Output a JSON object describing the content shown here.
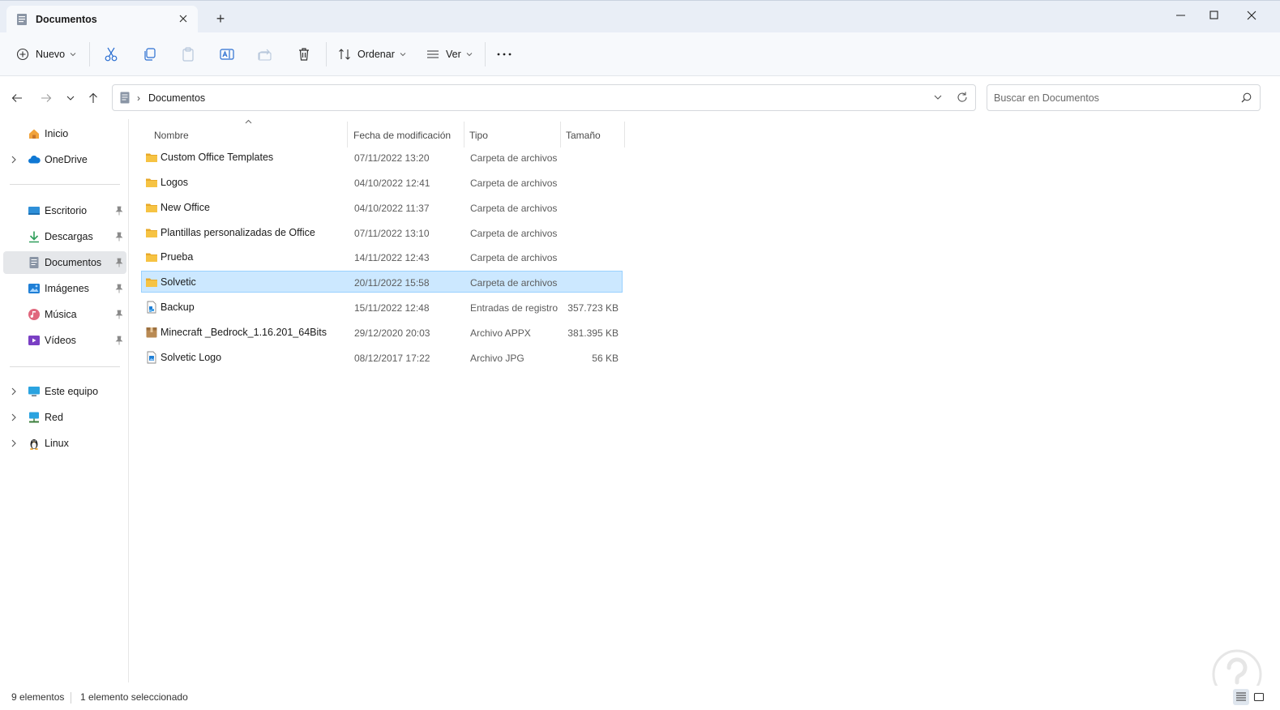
{
  "window": {
    "tab_title": "Documentos",
    "new_tab_label": "+"
  },
  "toolbar": {
    "new_label": "Nuevo",
    "sort_label": "Ordenar",
    "view_label": "Ver",
    "more_label": "···"
  },
  "address": {
    "crumb": "Documentos",
    "search_placeholder": "Buscar en Documentos"
  },
  "sidebar": {
    "items": [
      {
        "label": "Inicio",
        "icon": "home-icon"
      },
      {
        "label": "OneDrive",
        "icon": "cloud-icon"
      },
      {
        "label": "Escritorio",
        "icon": "desktop-icon"
      },
      {
        "label": "Descargas",
        "icon": "download-icon"
      },
      {
        "label": "Documentos",
        "icon": "document-icon"
      },
      {
        "label": "Imágenes",
        "icon": "image-icon"
      },
      {
        "label": "Música",
        "icon": "music-icon"
      },
      {
        "label": "Vídeos",
        "icon": "video-icon"
      },
      {
        "label": "Este equipo",
        "icon": "computer-icon"
      },
      {
        "label": "Red",
        "icon": "network-icon"
      },
      {
        "label": "Linux",
        "icon": "linux-icon"
      }
    ]
  },
  "files": {
    "columns": [
      "Nombre",
      "Fecha de modificación",
      "Tipo",
      "Tamaño"
    ],
    "rows": [
      {
        "name": "Custom Office Templates",
        "date": "07/11/2022 13:20",
        "type": "Carpeta de archivos",
        "size": "",
        "icon": "folder-icon"
      },
      {
        "name": "Logos",
        "date": "04/10/2022 12:41",
        "type": "Carpeta de archivos",
        "size": "",
        "icon": "folder-icon"
      },
      {
        "name": "New Office",
        "date": "04/10/2022 11:37",
        "type": "Carpeta de archivos",
        "size": "",
        "icon": "folder-icon"
      },
      {
        "name": "Plantillas personalizadas de Office",
        "date": "07/11/2022 13:10",
        "type": "Carpeta de archivos",
        "size": "",
        "icon": "folder-icon"
      },
      {
        "name": "Prueba",
        "date": "14/11/2022 12:43",
        "type": "Carpeta de archivos",
        "size": "",
        "icon": "folder-icon"
      },
      {
        "name": "Solvetic",
        "date": "20/11/2022 15:58",
        "type": "Carpeta de archivos",
        "size": "",
        "icon": "folder-icon",
        "selected": true
      },
      {
        "name": "Backup",
        "date": "15/11/2022 12:48",
        "type": "Entradas de registro",
        "size": "357.723 KB",
        "icon": "registry-file-icon"
      },
      {
        "name": "Minecraft _Bedrock_1.16.201_64Bits",
        "date": "29/12/2020 20:03",
        "type": "Archivo APPX",
        "size": "381.395 KB",
        "icon": "package-icon"
      },
      {
        "name": "Solvetic Logo",
        "date": "08/12/2017 17:22",
        "type": "Archivo JPG",
        "size": "56 KB",
        "icon": "image-file-icon"
      }
    ]
  },
  "status": {
    "count": "9 elementos",
    "selected": "1 elemento seleccionado"
  },
  "colors": {
    "selection_bg": "#cce8ff",
    "selection_border": "#99d1ff",
    "folder_yellow": "#f6c343",
    "accent_blue": "#0078d4"
  }
}
